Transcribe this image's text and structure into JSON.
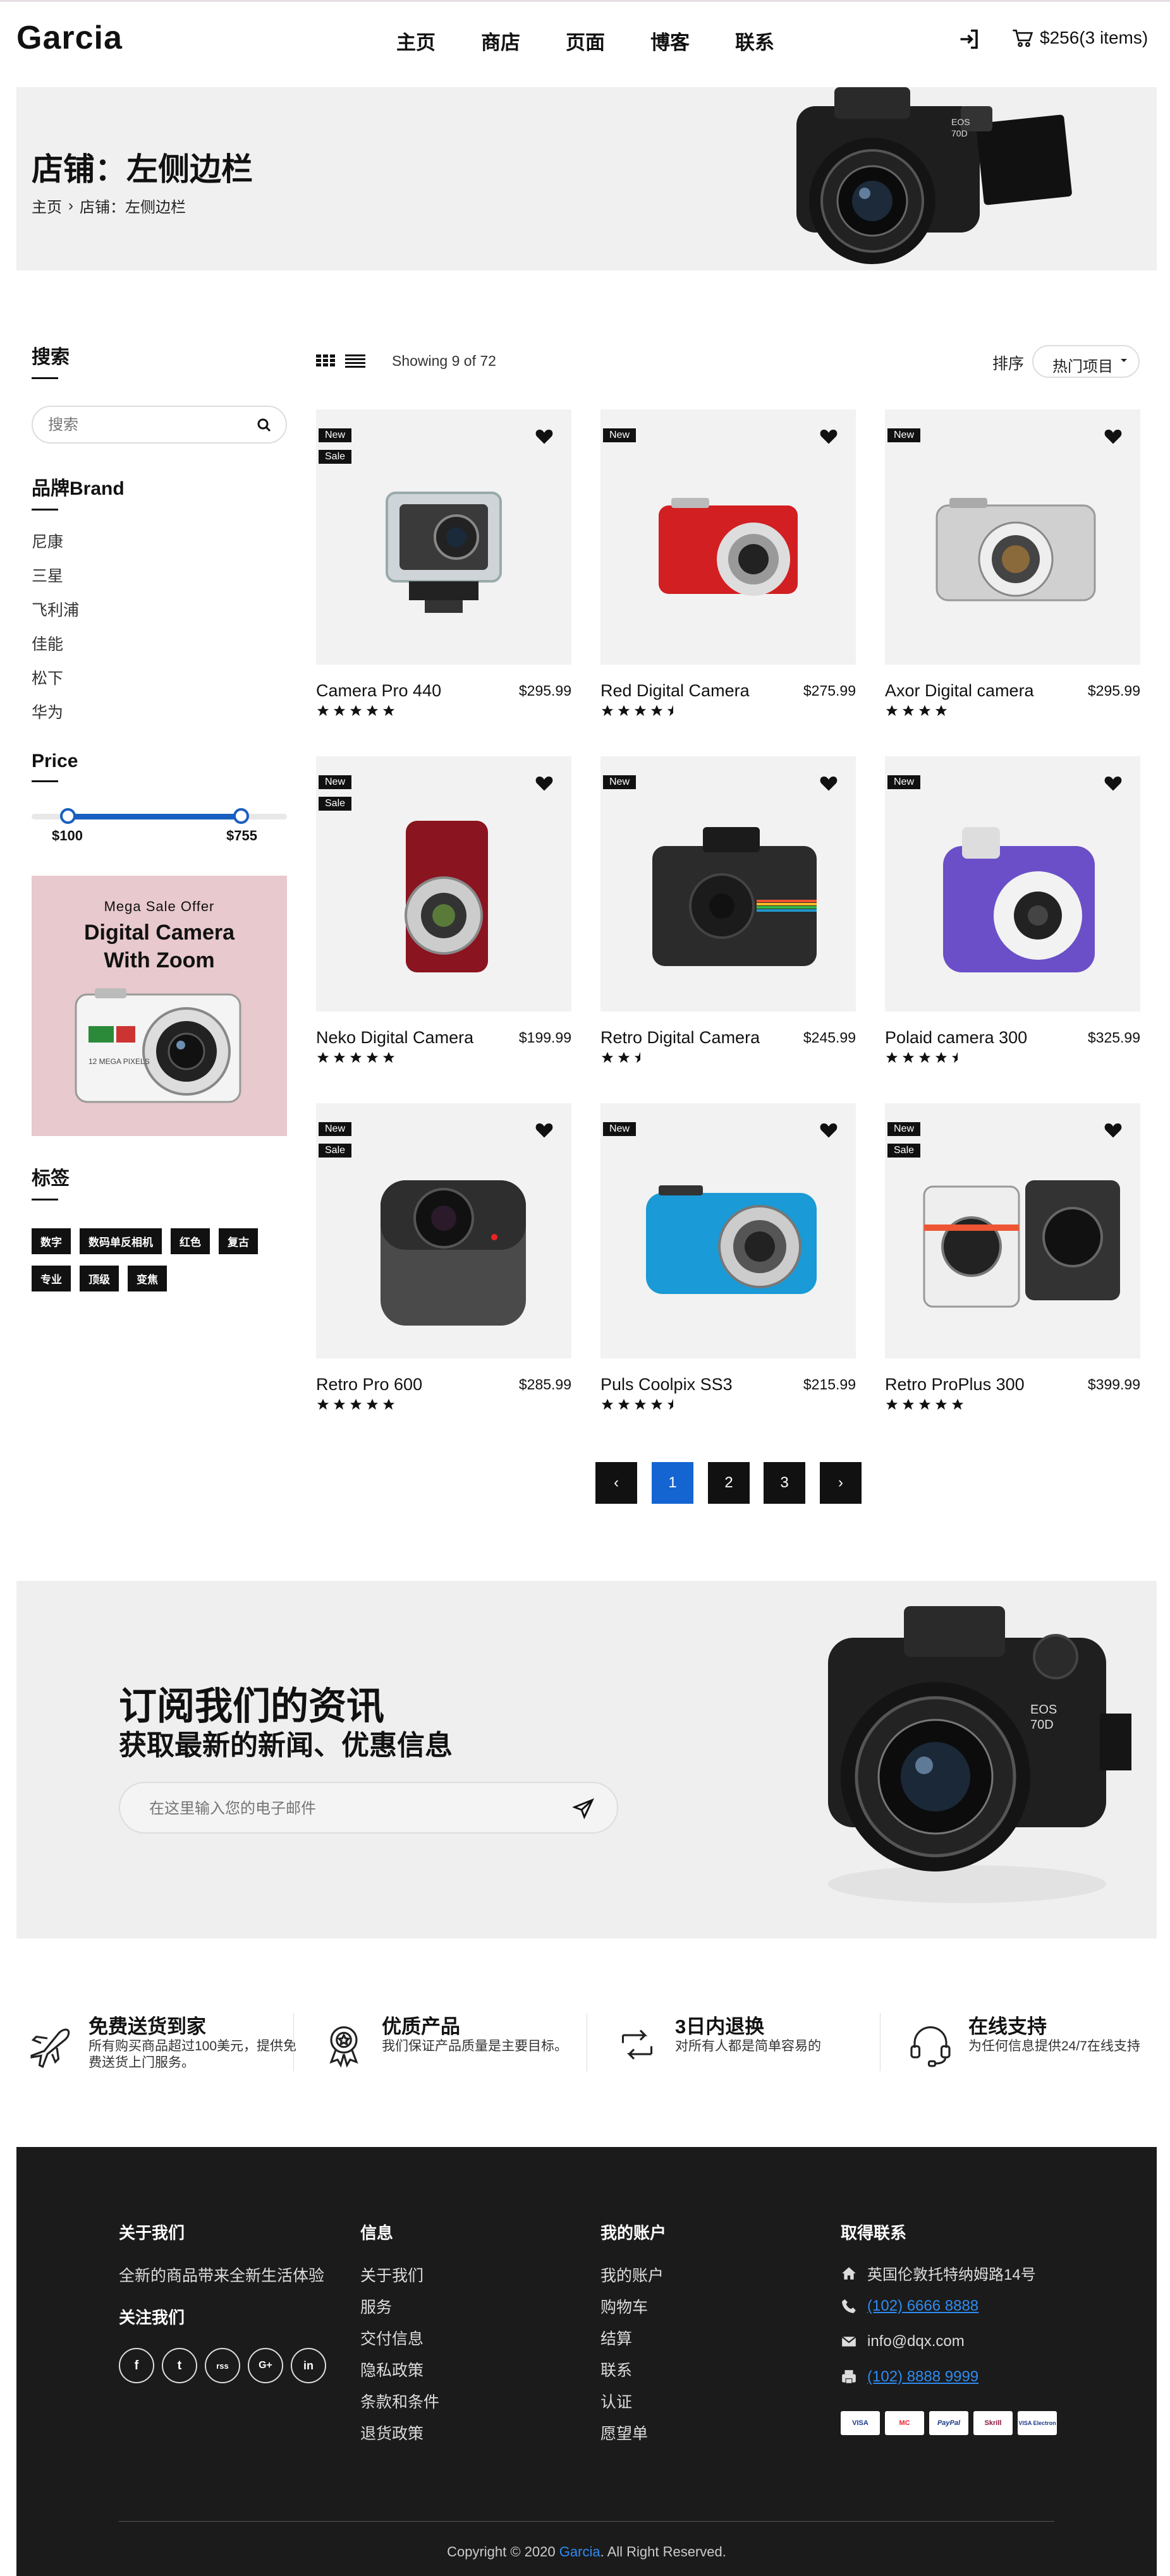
{
  "header": {
    "logo": "Garcia",
    "nav": [
      "主页",
      "商店",
      "页面",
      "博客",
      "联系"
    ],
    "cart": "$256(3 items)"
  },
  "hero": {
    "title": "店铺：左侧边栏",
    "breadcrumb_home": "主页",
    "breadcrumb_sep": "›",
    "breadcrumb_current": "店铺：左侧边栏"
  },
  "sidebar": {
    "search_title": "搜索",
    "search_placeholder": "搜索",
    "brand_title": "品牌Brand",
    "brands": [
      "尼康",
      "三星",
      "飞利浦",
      "佳能",
      "松下",
      "华为"
    ],
    "price_title": "Price",
    "price_min": "$100",
    "price_max": "$755",
    "price_range_fraction": [
      0.14,
      0.82
    ],
    "promo_small": "Mega Sale Offer",
    "promo_line1": "Digital Camera",
    "promo_line2": "With Zoom",
    "tags_title": "标签",
    "tags": [
      "数字",
      "数码单反相机",
      "红色",
      "复古",
      "专业",
      "顶级",
      "变焦"
    ]
  },
  "toolbar": {
    "showing": "Showing 9 of 72",
    "sort_label": "排序",
    "sort_value": "热门项目"
  },
  "products": [
    {
      "name": "Camera Pro 440",
      "price": "$295.99",
      "rating": 5,
      "badges": [
        "New",
        "Sale"
      ],
      "kind": "action"
    },
    {
      "name": "Red Digital Camera",
      "price": "$275.99",
      "rating": 4.5,
      "badges": [
        "New"
      ],
      "kind": "red"
    },
    {
      "name": "Axor Digital camera",
      "price": "$295.99",
      "rating": 4,
      "badges": [
        "New"
      ],
      "kind": "silver"
    },
    {
      "name": "Neko Digital Camera",
      "price": "$199.99",
      "rating": 5,
      "badges": [
        "New",
        "Sale"
      ],
      "kind": "darkred"
    },
    {
      "name": "Retro Digital Camera",
      "price": "$245.99",
      "rating": 2.5,
      "badges": [
        "New"
      ],
      "kind": "polaroid"
    },
    {
      "name": "Polaid camera 300",
      "price": "$325.99",
      "rating": 4.5,
      "badges": [
        "New"
      ],
      "kind": "purple"
    },
    {
      "name": "Retro Pro 600",
      "price": "$285.99",
      "rating": 5,
      "badges": [
        "New",
        "Sale"
      ],
      "kind": "cube"
    },
    {
      "name": "Puls Coolpix SS3",
      "price": "$215.99",
      "rating": 4.5,
      "badges": [
        "New"
      ],
      "kind": "blue"
    },
    {
      "name": "Retro ProPlus 300",
      "price": "$399.99",
      "rating": 5,
      "badges": [
        "New",
        "Sale"
      ],
      "kind": "twin"
    }
  ],
  "pagination": {
    "prev": "‹",
    "pages": [
      "1",
      "2",
      "3"
    ],
    "next": "›",
    "active": "1"
  },
  "newsletter": {
    "title": "订阅我们的资讯",
    "subtitle": "获取最新的新闻、优惠信息",
    "placeholder": "在这里输入您的电子邮件"
  },
  "features": [
    {
      "title": "免费送货到家",
      "desc": "所有购买商品超过100美元，提供免费送货上门服务。",
      "icon": "plane-icon"
    },
    {
      "title": "优质产品",
      "desc": "我们保证产品质量是主要目标。",
      "icon": "award-icon"
    },
    {
      "title": "3日内退换",
      "desc": "对所有人都是简单容易的",
      "icon": "return-icon"
    },
    {
      "title": "在线支持",
      "desc": "为任何信息提供24/7在线支持",
      "icon": "headset-icon"
    }
  ],
  "footer": {
    "about_title": "关于我们",
    "about_text": "全新的商品带来全新生活体验",
    "follow_title": "关注我们",
    "social": [
      "f",
      "t",
      "rss",
      "G+",
      "in"
    ],
    "info_title": "信息",
    "info_links": [
      "关于我们",
      "服务",
      "交付信息",
      "隐私政策",
      "条款和条件",
      "退货政策"
    ],
    "account_title": "我的账户",
    "account_links": [
      "我的账户",
      "购物车",
      "结算",
      "联系",
      "认证",
      "愿望单"
    ],
    "contact_title": "取得联系",
    "address": "英国伦敦托特纳姆路14号",
    "phone": "(102) 6666 8888",
    "email": "info@dqx.com",
    "fax": "(102) 8888 9999",
    "payments": [
      "VISA",
      "MC",
      "PayPal",
      "Skrill",
      "VISA Electron"
    ],
    "copyright_pre": "Copyright © 2020 ",
    "copyright_brand": "Garcia",
    "copyright_post": ". All Right Reserved."
  },
  "colors": {
    "accent": "#1464d2",
    "dark": "#111111",
    "footer_bg": "#1b1b1b",
    "promo_bg": "#e8c9cd"
  }
}
